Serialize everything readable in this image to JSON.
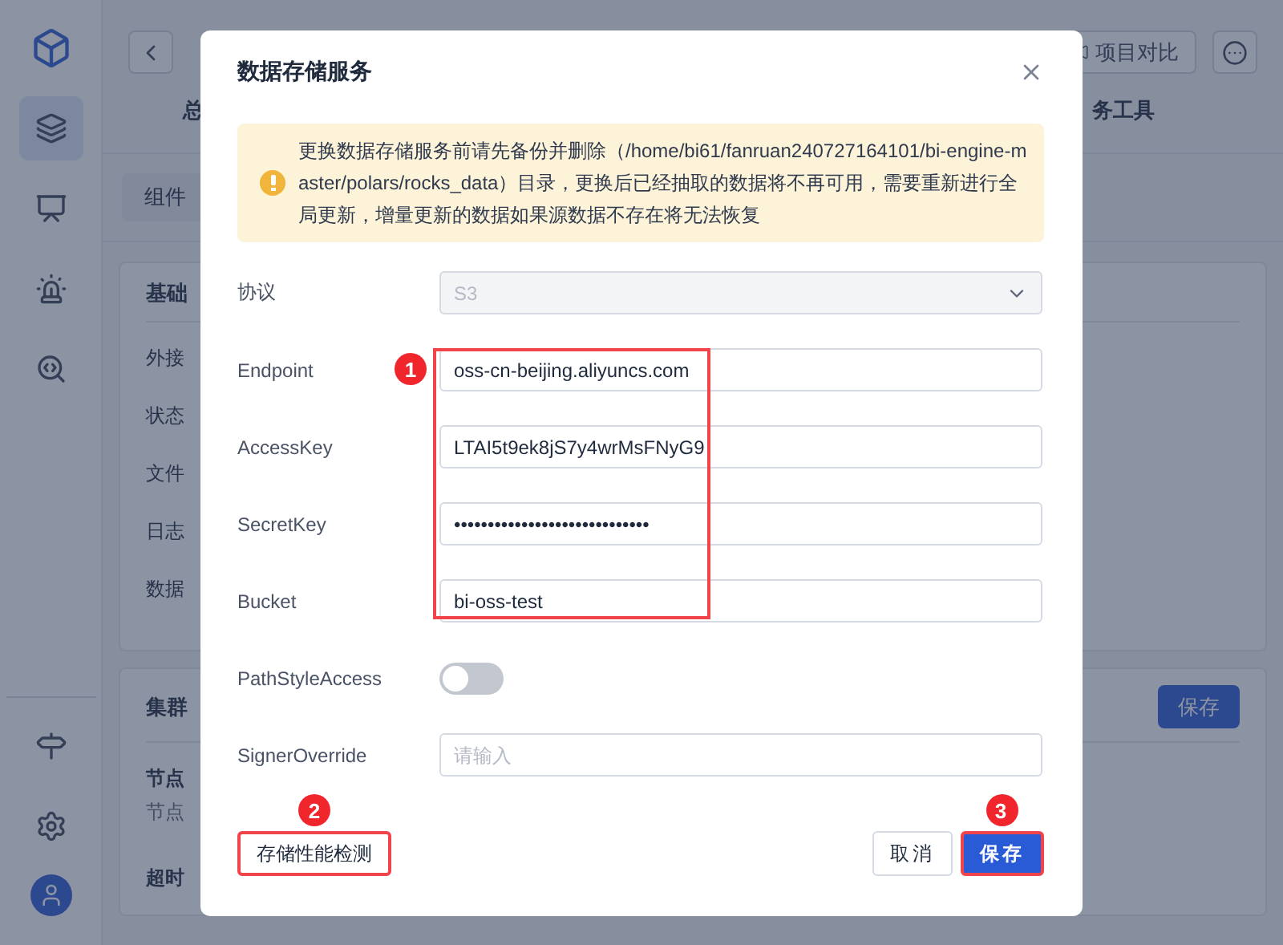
{
  "sidebar": {
    "items": [
      {
        "selected": false,
        "kind": "logo"
      },
      {
        "selected": true,
        "kind": "layers"
      },
      {
        "selected": false,
        "kind": "monitor"
      },
      {
        "selected": false,
        "kind": "alarm"
      },
      {
        "selected": false,
        "kind": "tool"
      }
    ]
  },
  "header": {
    "compare_button": "项目对比"
  },
  "tabs": [
    "总",
    "务工具"
  ],
  "subtab": "组件",
  "cards": [
    {
      "title": "基础",
      "items": [
        "外接",
        "状态",
        "文件",
        "日志",
        "数据"
      ]
    },
    {
      "title": "集群",
      "save_button": "保存",
      "rows": [
        {
          "kind": "heading",
          "text": "节点"
        },
        {
          "kind": "note",
          "text": "节点"
        },
        {
          "kind": "heading",
          "text": "超时"
        }
      ]
    }
  ],
  "dialog": {
    "title": "数据存储服务",
    "alert": "更换数据存储服务前请先备份并删除（/home/bi61/fanruan240727164101/bi-engine-master/polars/rocks_data）目录，更换后已经抽取的数据将不再可用，需要重新进行全局更新，增量更新的数据如果源数据不存在将无法恢复",
    "fields": [
      {
        "label": "协议",
        "kind": "select",
        "value": "S3",
        "disabled": true
      },
      {
        "label": "Endpoint",
        "kind": "text",
        "value": "oss-cn-beijing.aliyuncs.com"
      },
      {
        "label": "AccessKey",
        "kind": "text",
        "value": "LTAI5t9ek8jS7y4wrMsFNyG9"
      },
      {
        "label": "SecretKey",
        "kind": "text",
        "value": "•••••••••••••••••••••••••••••"
      },
      {
        "label": "Bucket",
        "kind": "text",
        "value": "bi-oss-test"
      },
      {
        "label": "PathStyleAccess",
        "kind": "toggle",
        "on": false
      },
      {
        "label": "SignerOverride",
        "kind": "text",
        "placeholder": "请输入"
      }
    ],
    "check_button": "存储性能检测",
    "cancel_button": "取消",
    "save_button": "保存",
    "badges": {
      "fields": "1",
      "check": "2",
      "save": "3"
    }
  }
}
